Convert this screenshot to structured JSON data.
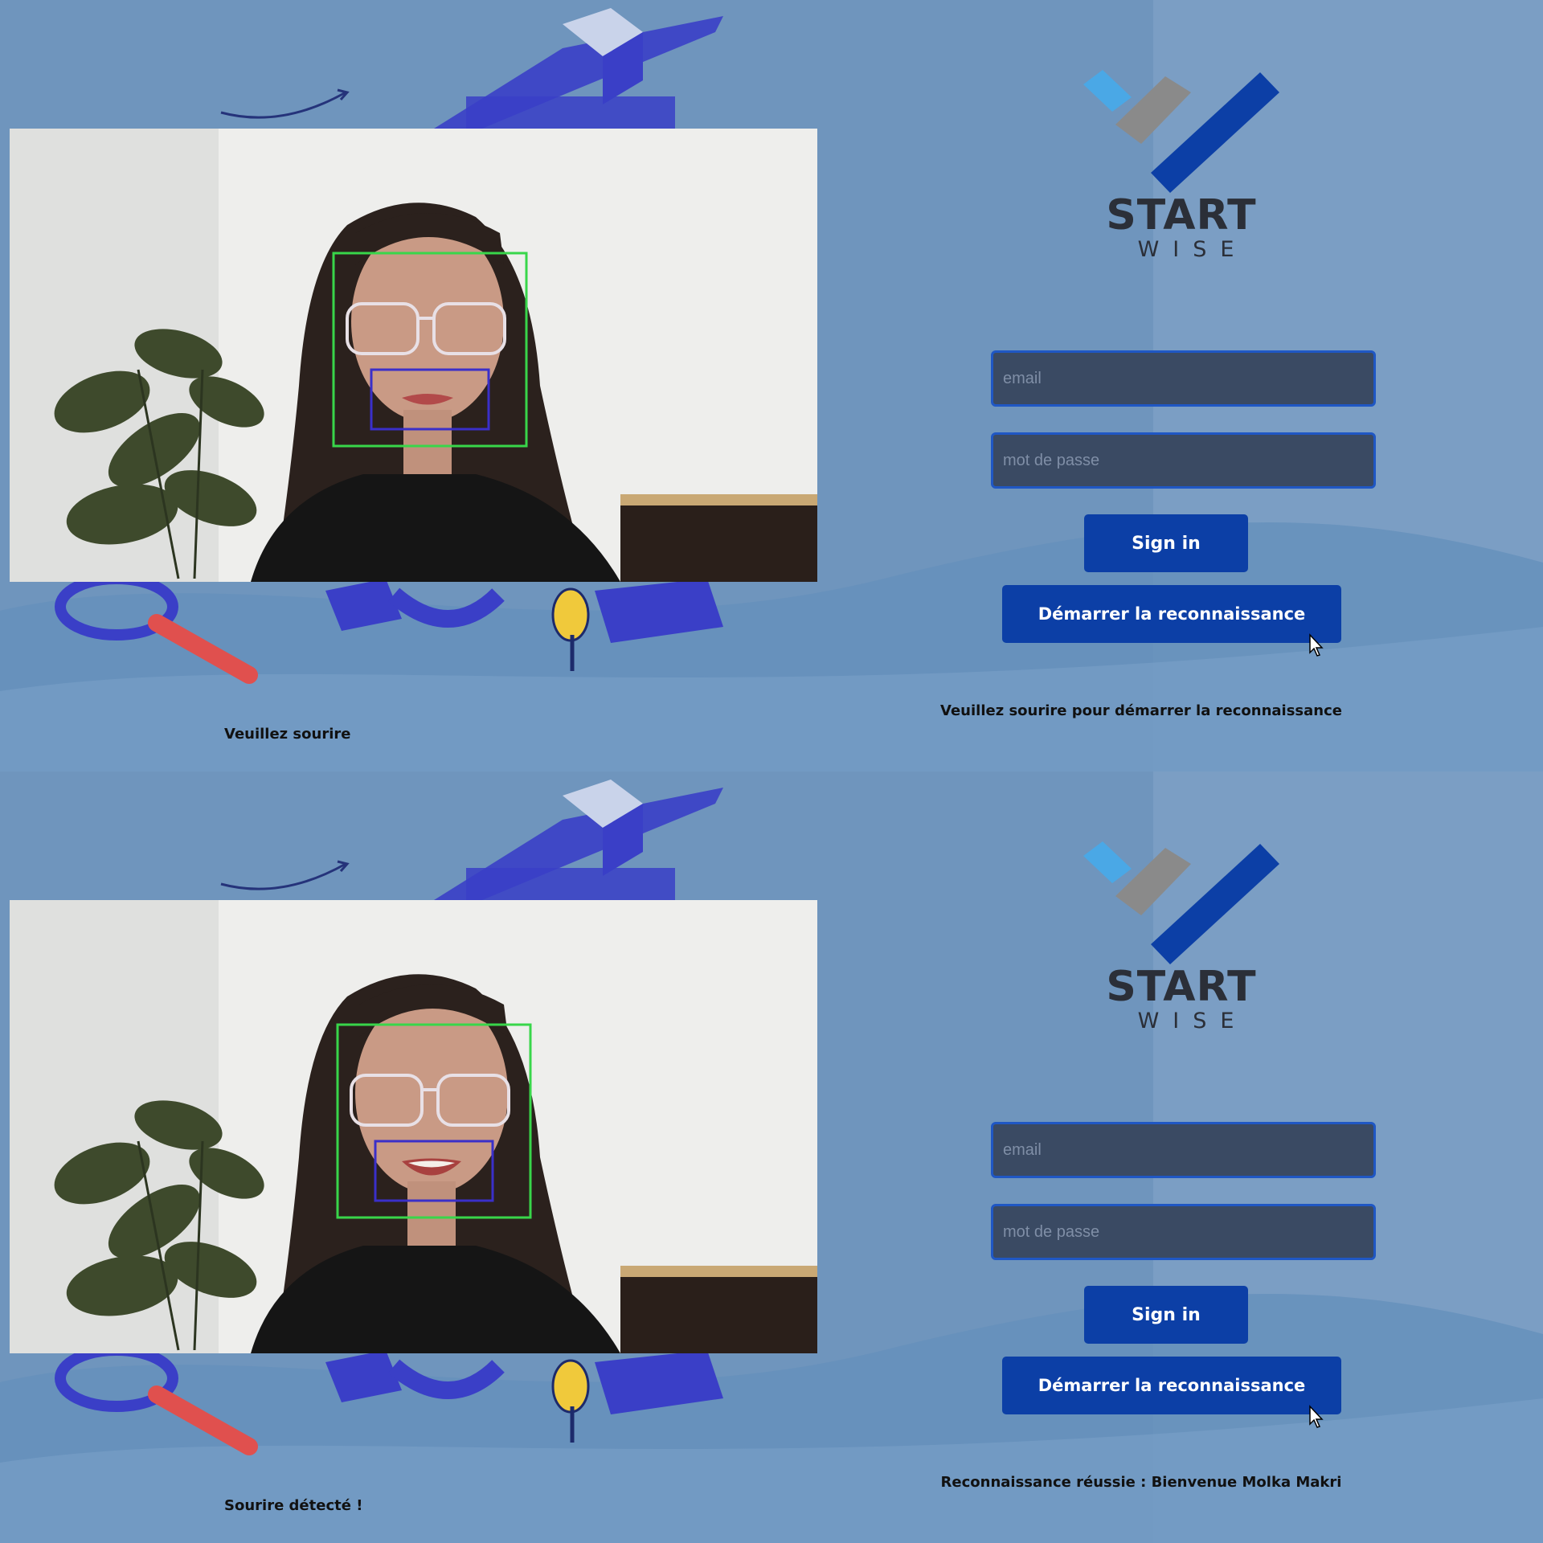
{
  "panels": [
    {
      "email_placeholder": "email",
      "password_placeholder": "mot de passe",
      "signin_label": "Sign in",
      "start_recognition_label": "Démarrer la reconnaissance",
      "status_message": "Veuillez sourire pour démarrer la reconnaissance",
      "camera_hint": "Veuillez sourire",
      "smile_detected": false
    },
    {
      "email_placeholder": "email",
      "password_placeholder": "mot de passe",
      "signin_label": "Sign in",
      "start_recognition_label": "Démarrer la reconnaissance",
      "status_message": "Reconnaissance réussie : Bienvenue Molka Makri",
      "camera_hint": "Sourire détecté !",
      "smile_detected": true
    }
  ],
  "brand": {
    "name": "START",
    "tagline": "WISE"
  },
  "colors": {
    "background": "#6f95bd",
    "button": "#0c3fa6",
    "field": "#3a4a63",
    "field_border": "#1f57c4",
    "face_box": "#38d64a",
    "mouth_box": "#3a2fc9"
  },
  "icons": [
    "startwise-logo-icon",
    "mouse-cursor-icon"
  ]
}
